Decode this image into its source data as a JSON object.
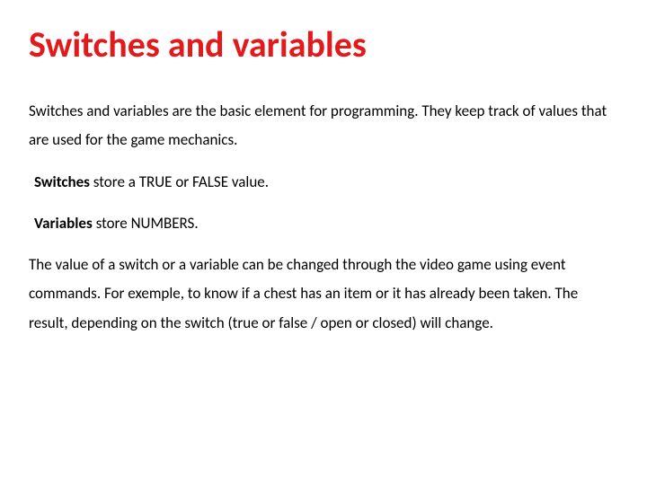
{
  "title": "Switches and variables",
  "intro": "Switches and variables are the basic element for programming. They keep track of values that are used for the game mechanics.",
  "switches_label": "Switches",
  "switches_rest": " store a TRUE or FALSE value.",
  "variables_label": "Variables",
  "variables_rest": " store NUMBERS.",
  "detail": "The value of a switch or a variable can be changed through the video game using event commands. For exemple, to know if a chest has an item or it has already been taken. The result, depending on the switch (true or false / open or closed) will change."
}
